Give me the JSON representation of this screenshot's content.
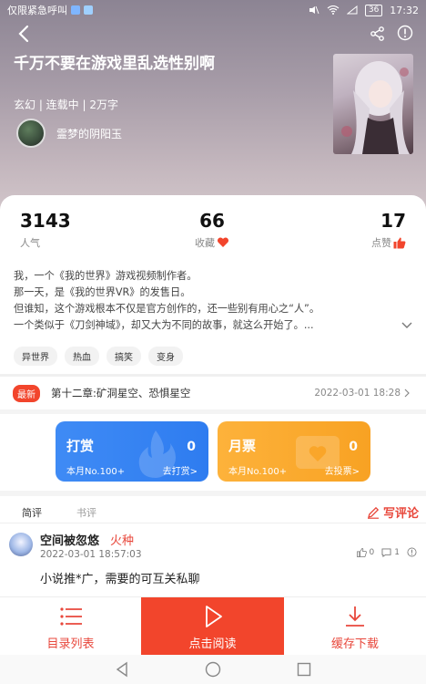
{
  "status_bar": {
    "left_text": "仅限紧急呼叫",
    "battery": "36",
    "time": "17:32"
  },
  "book": {
    "title": "千万不要在游戏里乱选性别啊",
    "meta": "玄幻 | 连载中 | 2万字",
    "author": "霊梦的阴阳玉"
  },
  "stats": {
    "popularity_value": "3143",
    "popularity_label": "人气",
    "favorites_value": "66",
    "favorites_label": "收藏",
    "likes_value": "17",
    "likes_label": "点赞"
  },
  "description": {
    "line1": "我，一个《我的世界》游戏视频制作者。",
    "line2": "那一天，是《我的世界VR》的发售日。",
    "line3": "但谁知，这个游戏根本不仅是官方创作的，还一些别有用心之“人”。",
    "line4": "一个类似于《刀剑神域》，却又大为不同的故事，就这么开始了。..."
  },
  "tags": [
    "异世界",
    "热血",
    "搞笑",
    "变身"
  ],
  "latest": {
    "badge": "最新",
    "chapter": "第十二章:矿洞星空、恐惧星空",
    "date": "2022-03-01 18:28"
  },
  "gifts": {
    "reward": {
      "title": "打赏",
      "count": "0",
      "rank": "本月No.100+",
      "action": "去打赏>"
    },
    "ticket": {
      "title": "月票",
      "count": "0",
      "rank": "本月No.100+",
      "action": "去投票>"
    }
  },
  "comments": {
    "tab_short": "简评",
    "tab_long": "书评",
    "write_label": "写评论",
    "items": [
      {
        "user": "空间被忽悠",
        "tag": "火种",
        "date": "2022-03-01 18:57:03",
        "likes": "0",
        "replies": "1",
        "text": "小说推*广，需要的可互关私聊"
      }
    ]
  },
  "bottom_bar": {
    "catalog": "目录列表",
    "read": "点击阅读",
    "download": "缓存下载"
  },
  "colors": {
    "accent": "#f2452c",
    "reward_blue": "#3f8bf5",
    "ticket_orange": "#fdb23b"
  }
}
